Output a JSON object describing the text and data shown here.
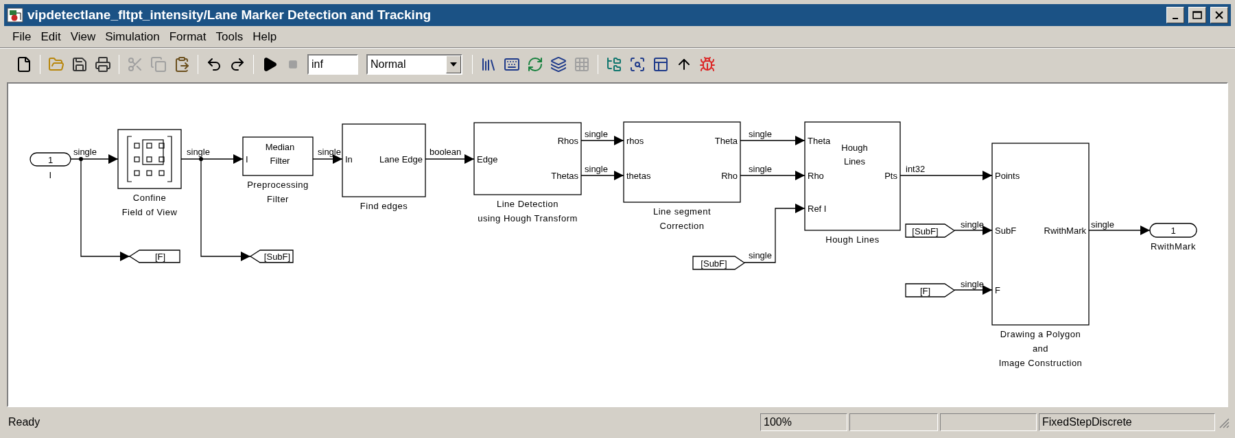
{
  "window": {
    "title": "vipdetectlane_fltpt_intensity/Lane Marker Detection and Tracking"
  },
  "menu": [
    "File",
    "Edit",
    "View",
    "Simulation",
    "Format",
    "Tools",
    "Help"
  ],
  "toolbar": [
    {
      "kind": "new",
      "disabled": false
    },
    {
      "kind": "separator"
    },
    {
      "kind": "open",
      "disabled": false
    },
    {
      "kind": "save",
      "disabled": false
    },
    {
      "kind": "print",
      "disabled": false
    },
    {
      "kind": "separator"
    },
    {
      "kind": "cut",
      "disabled": true
    },
    {
      "kind": "copy",
      "disabled": true
    },
    {
      "kind": "paste",
      "disabled": false
    },
    {
      "kind": "separator"
    },
    {
      "kind": "undo",
      "disabled": false
    },
    {
      "kind": "redo",
      "disabled": false
    },
    {
      "kind": "separator"
    },
    {
      "kind": "start",
      "disabled": false
    },
    {
      "kind": "stop",
      "disabled": true
    },
    {
      "kind": "field",
      "value": "inf"
    },
    {
      "kind": "select",
      "value": "Normal"
    },
    {
      "kind": "separator"
    },
    {
      "kind": "library",
      "disabled": false
    },
    {
      "kind": "keyboard",
      "disabled": false
    },
    {
      "kind": "refresh",
      "disabled": false
    },
    {
      "kind": "layers",
      "disabled": false
    },
    {
      "kind": "grid",
      "disabled": true
    },
    {
      "kind": "separator"
    },
    {
      "kind": "tree",
      "disabled": false
    },
    {
      "kind": "explorer",
      "disabled": false
    },
    {
      "kind": "browser",
      "disabled": false
    },
    {
      "kind": "up",
      "disabled": false
    },
    {
      "kind": "debug",
      "disabled": false
    }
  ],
  "diagram": {
    "blocks": [
      {
        "kind": "inport",
        "number": "1",
        "caption": [
          "I"
        ]
      },
      {
        "kind": "image",
        "caption": [
          "Confine",
          "Field of View"
        ]
      },
      {
        "kind": "block",
        "inputs": [
          "I"
        ],
        "text": [
          "Median",
          "Filter"
        ],
        "caption": [
          "Preprocessing",
          "Filter"
        ]
      },
      {
        "kind": "block",
        "inputs": [
          "In"
        ],
        "outputs": [
          "Lane Edge"
        ],
        "caption": [
          "Find edges"
        ]
      },
      {
        "kind": "block",
        "inputs": [
          "Edge"
        ],
        "outputs": [
          "Rhos",
          "Thetas"
        ],
        "caption": [
          "Line Detection",
          "using Hough Transform"
        ]
      },
      {
        "kind": "block",
        "inputs": [
          "rhos",
          "thetas"
        ],
        "outputs": [
          "Theta",
          "Rho"
        ],
        "caption": [
          "Line segment",
          "Correction"
        ]
      },
      {
        "kind": "block",
        "inputs": [
          "Theta",
          "Rho",
          "Ref I"
        ],
        "outputs": [
          "Pts"
        ],
        "text": [
          "Hough",
          "Lines"
        ],
        "caption": [
          "Hough Lines"
        ]
      },
      {
        "kind": "block",
        "inputs": [
          "Points",
          "SubF",
          "F"
        ],
        "outputs": [
          "RwithMark"
        ],
        "caption": [
          "Drawing a Polygon",
          "and",
          "Image Construction"
        ]
      },
      {
        "kind": "outport",
        "number": "1",
        "caption": [
          "RwithMark"
        ]
      },
      {
        "kind": "goto",
        "tag": "[F]"
      },
      {
        "kind": "goto",
        "tag": "[SubF]"
      },
      {
        "kind": "from",
        "tag": "[SubF]"
      },
      {
        "kind": "from",
        "tag": "[SubF]"
      },
      {
        "kind": "from",
        "tag": "[F]"
      }
    ],
    "signals": [
      {
        "label": "single"
      },
      {
        "label": "single"
      },
      {
        "label": "single"
      },
      {
        "label": "boolean"
      },
      {
        "label": "single"
      },
      {
        "label": "single"
      },
      {
        "label": "single"
      },
      {
        "label": "single"
      },
      {
        "label": "int32"
      },
      {
        "label": "single"
      },
      {
        "label": "single"
      },
      {
        "label": "single"
      },
      {
        "label": "single"
      }
    ]
  },
  "status_bar": {
    "message": "Ready",
    "zoom": "100%",
    "solver": "FixedStepDiscrete"
  }
}
